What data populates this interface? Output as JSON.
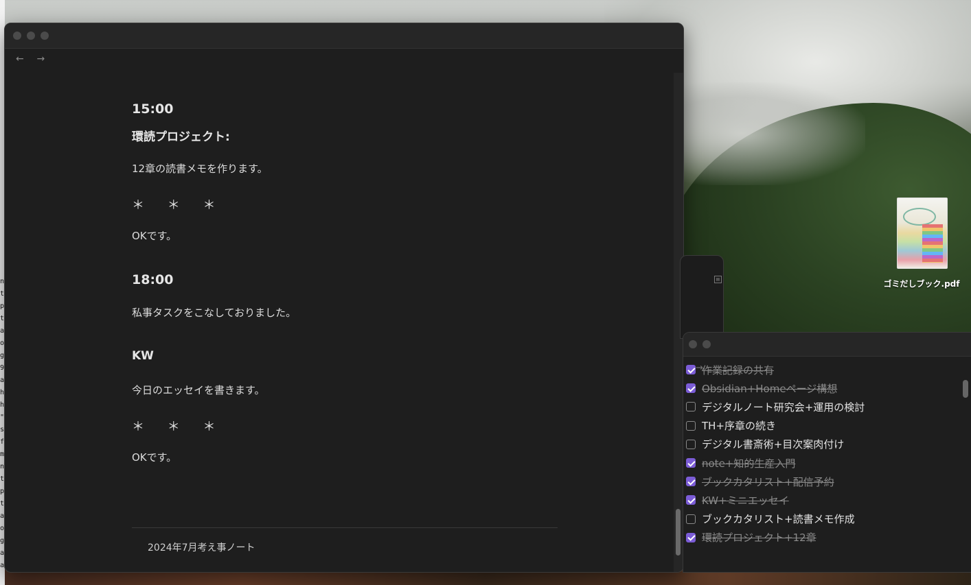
{
  "note": {
    "blocks": [
      {
        "kind": "heading",
        "text": "15:00"
      },
      {
        "kind": "heading",
        "text": "環読プロジェクト:"
      },
      {
        "kind": "text",
        "text": "12章の読書メモを作ります。"
      },
      {
        "kind": "stars",
        "text": "＊ ＊ ＊"
      },
      {
        "kind": "text",
        "text": "OKです。"
      },
      {
        "kind": "heading",
        "text": "18:00"
      },
      {
        "kind": "text",
        "text": "私事タスクをこなしておりました。"
      },
      {
        "kind": "heading",
        "text": "KW"
      },
      {
        "kind": "text",
        "text": "今日のエッセイを書きます。"
      },
      {
        "kind": "stars",
        "text": "＊ ＊ ＊"
      },
      {
        "kind": "text",
        "text": "OKです。"
      }
    ],
    "backlink": "2024年7月考え事ノート"
  },
  "nav": {
    "back": "←",
    "forward": "→"
  },
  "todo": {
    "nav_forward": "→",
    "items": [
      {
        "label": "作業記録の共有",
        "done": true
      },
      {
        "label": "Obsidian+Homeページ構想",
        "done": true
      },
      {
        "label": "デジタルノート研究会+運用の検討",
        "done": false
      },
      {
        "label": "TH+序章の続き",
        "done": false
      },
      {
        "label": "デジタル書斎術+目次案肉付け",
        "done": false
      },
      {
        "label": "note+知的生産入門",
        "done": true
      },
      {
        "label": "ブックカタリスト+配信予約",
        "done": true
      },
      {
        "label": "KW+ミニエッセイ",
        "done": true
      },
      {
        "label": "ブックカタリスト+読書メモ作成",
        "done": false
      },
      {
        "label": "環読プロジェクト+12章",
        "done": true
      }
    ]
  },
  "desktop": {
    "file_name": "ゴミだしブック.pdf",
    "left_letters": [
      "n",
      "t",
      "p",
      "t",
      "a",
      "o",
      "g",
      "9",
      "a",
      "h",
      "h",
      "\"",
      "s",
      "f",
      "m",
      "n",
      "t",
      "p",
      "t",
      "a",
      "o",
      "g",
      "a",
      "a"
    ]
  },
  "colors": {
    "accent": "#7b5cd6",
    "window_bg": "#1e1e1e"
  }
}
